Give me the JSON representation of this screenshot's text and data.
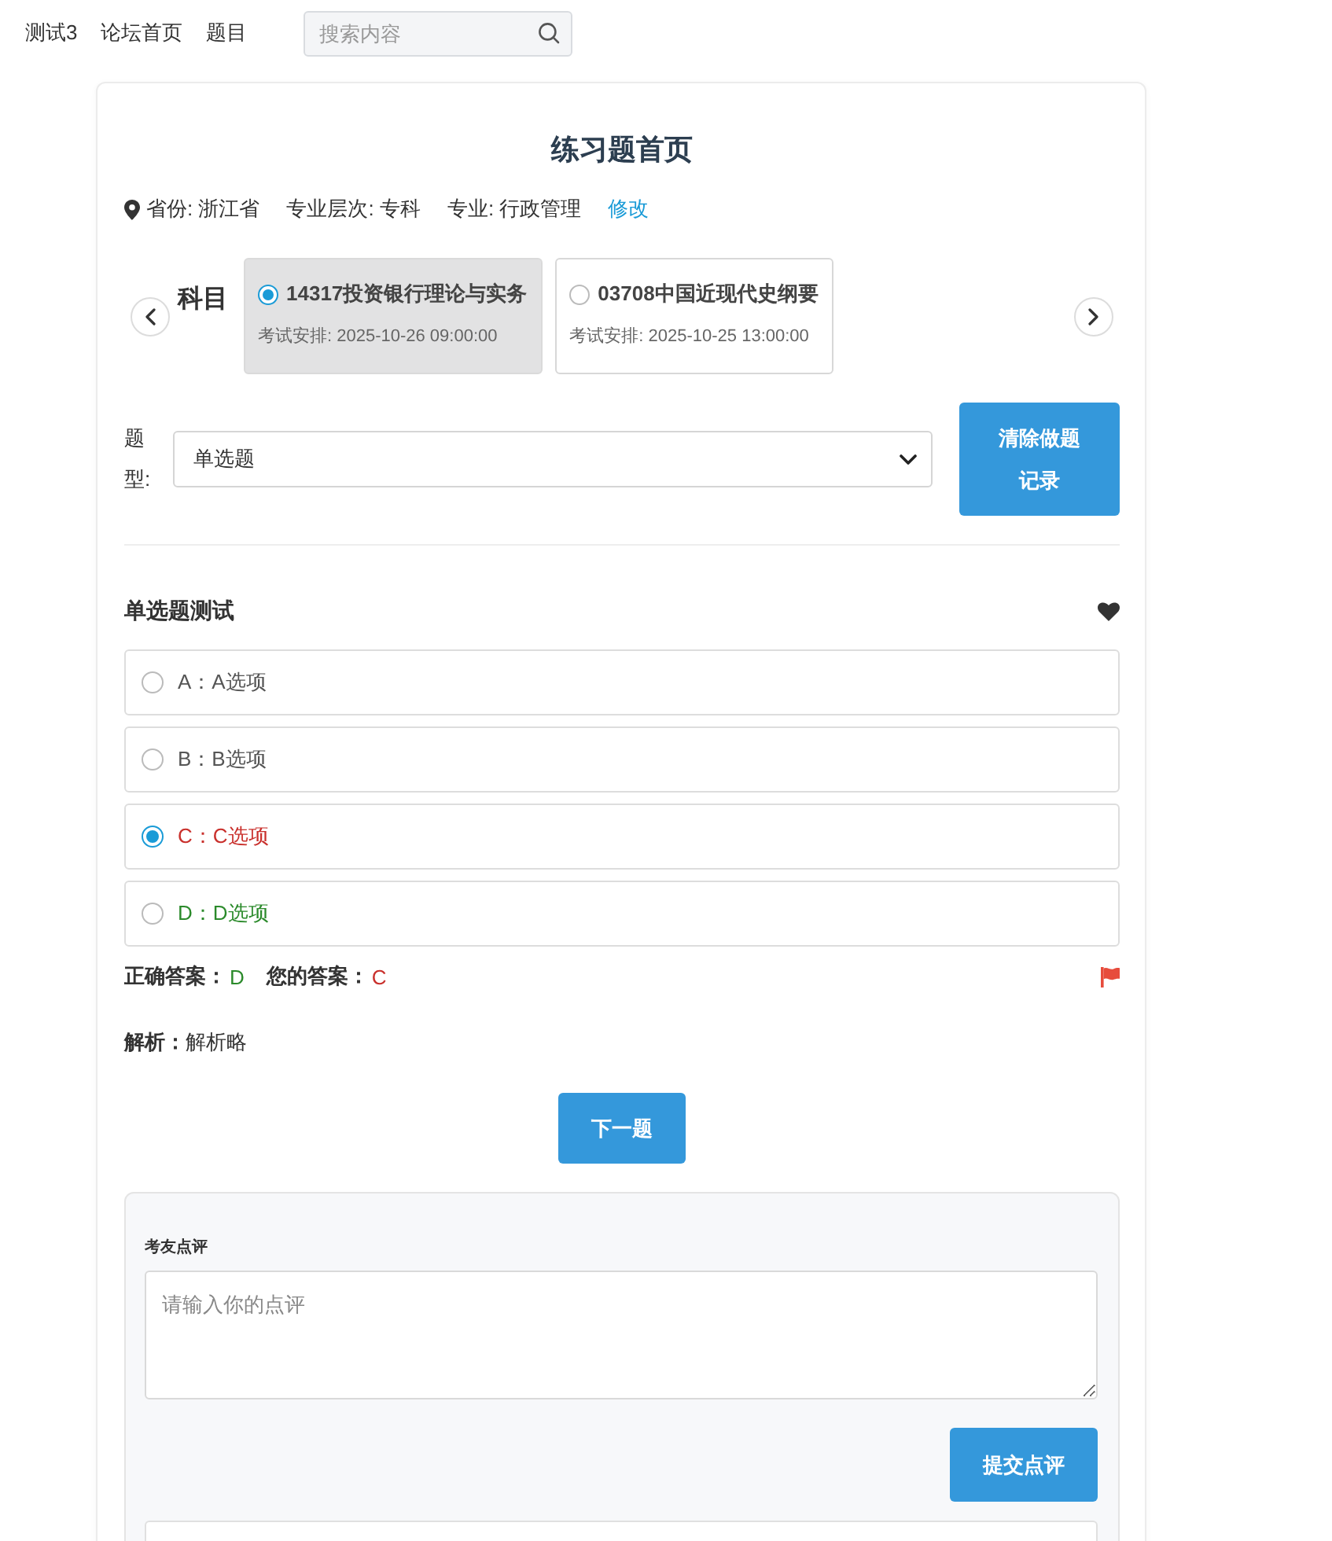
{
  "nav": {
    "links": [
      {
        "label": "测试3"
      },
      {
        "label": "论坛首页"
      },
      {
        "label": "题目"
      }
    ],
    "search": {
      "placeholder": "搜索内容"
    }
  },
  "page": {
    "title": "练习题首页"
  },
  "profile": {
    "items": [
      "省份: 浙江省",
      "专业层次: 专科",
      "专业: 行政管理"
    ],
    "edit_link": "修改"
  },
  "subjects": {
    "label": "科目",
    "items": [
      {
        "name": "14317投资银行理论与实务",
        "schedule": "考试安排: 2025-10-26 09:00:00",
        "selected": true
      },
      {
        "name": "03708中国近现代史纲要",
        "schedule": "考试安排: 2025-10-25 13:00:00",
        "selected": false
      }
    ]
  },
  "filter": {
    "label": "题型:",
    "value": "单选题",
    "clear_button": "清除做题记录"
  },
  "question": {
    "title": "单选题测试",
    "options": [
      {
        "text": "A：A选项",
        "selected": false,
        "correct": false
      },
      {
        "text": "B：B选项",
        "selected": false,
        "correct": false
      },
      {
        "text": "C：C选项",
        "selected": true,
        "correct": false
      },
      {
        "text": "D：D选项",
        "selected": false,
        "correct": true
      }
    ],
    "answer": {
      "correct_label": "正确答案：",
      "correct_value": "D",
      "user_label": "您的答案：",
      "user_value": "C"
    },
    "analysis": {
      "label": "解析：",
      "text": "解析略"
    },
    "next_button": "下一题"
  },
  "comments": {
    "title": "考友点评",
    "placeholder": "请输入你的点评",
    "submit_button": "提交点评"
  }
}
